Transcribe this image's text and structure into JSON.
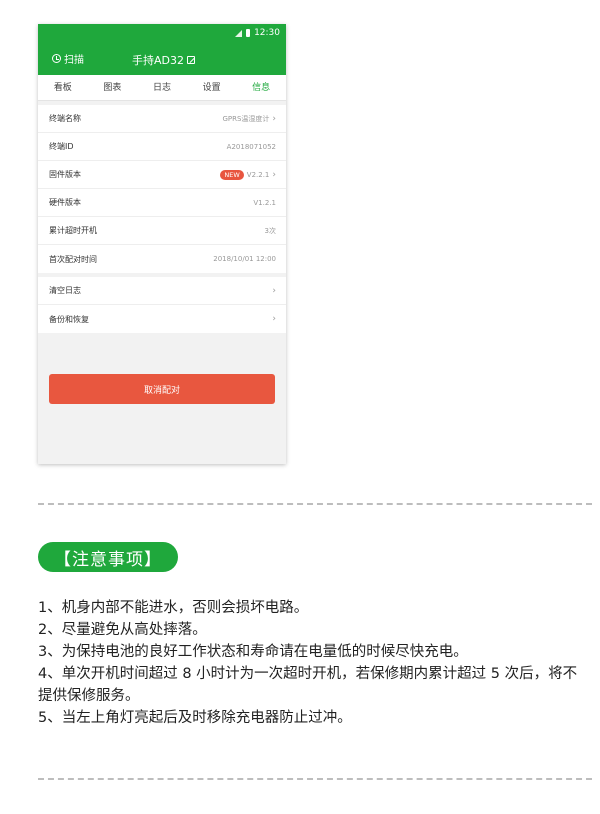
{
  "status_bar": {
    "time": "12:30"
  },
  "app_bar": {
    "scan_label": "扫描",
    "device_title": "手持AD32"
  },
  "tabs": [
    {
      "label": "看板",
      "active": false
    },
    {
      "label": "图表",
      "active": false
    },
    {
      "label": "日志",
      "active": false
    },
    {
      "label": "设置",
      "active": false
    },
    {
      "label": "信息",
      "active": true
    }
  ],
  "info_rows": [
    {
      "label": "终端名称",
      "value": "GPRS温湿度计",
      "badge": "",
      "chevron": true
    },
    {
      "label": "终端ID",
      "value": "A2018071052",
      "badge": "",
      "chevron": false
    },
    {
      "label": "固件版本",
      "value": "V2.2.1",
      "badge": "NEW",
      "chevron": true
    },
    {
      "label": "硬件版本",
      "value": "V1.2.1",
      "badge": "",
      "chevron": false
    },
    {
      "label": "累计超时开机",
      "value": "3次",
      "badge": "",
      "chevron": false
    },
    {
      "label": "首次配对时间",
      "value": "2018/10/01 12:00",
      "badge": "",
      "chevron": false
    }
  ],
  "action_rows": [
    {
      "label": "清空日志"
    },
    {
      "label": "备份和恢复"
    }
  ],
  "unpair_button": "取消配对",
  "notice_title": "【注意事项】",
  "notes": [
    "1、机身内部不能进水，否则会损坏电路。",
    "2、尽量避免从高处摔落。",
    "3、为保持电池的良好工作状态和寿命请在电量低的时候尽快充电。",
    "4、单次开机时间超过 8 小时计为一次超时开机，若保修期内累计超过 5 次后，将不提供保修服务。",
    "5、当左上角灯亮起后及时移除充电器防止过冲。"
  ],
  "colors": {
    "brand_green": "#1fa83c",
    "danger_red": "#e8573f"
  }
}
